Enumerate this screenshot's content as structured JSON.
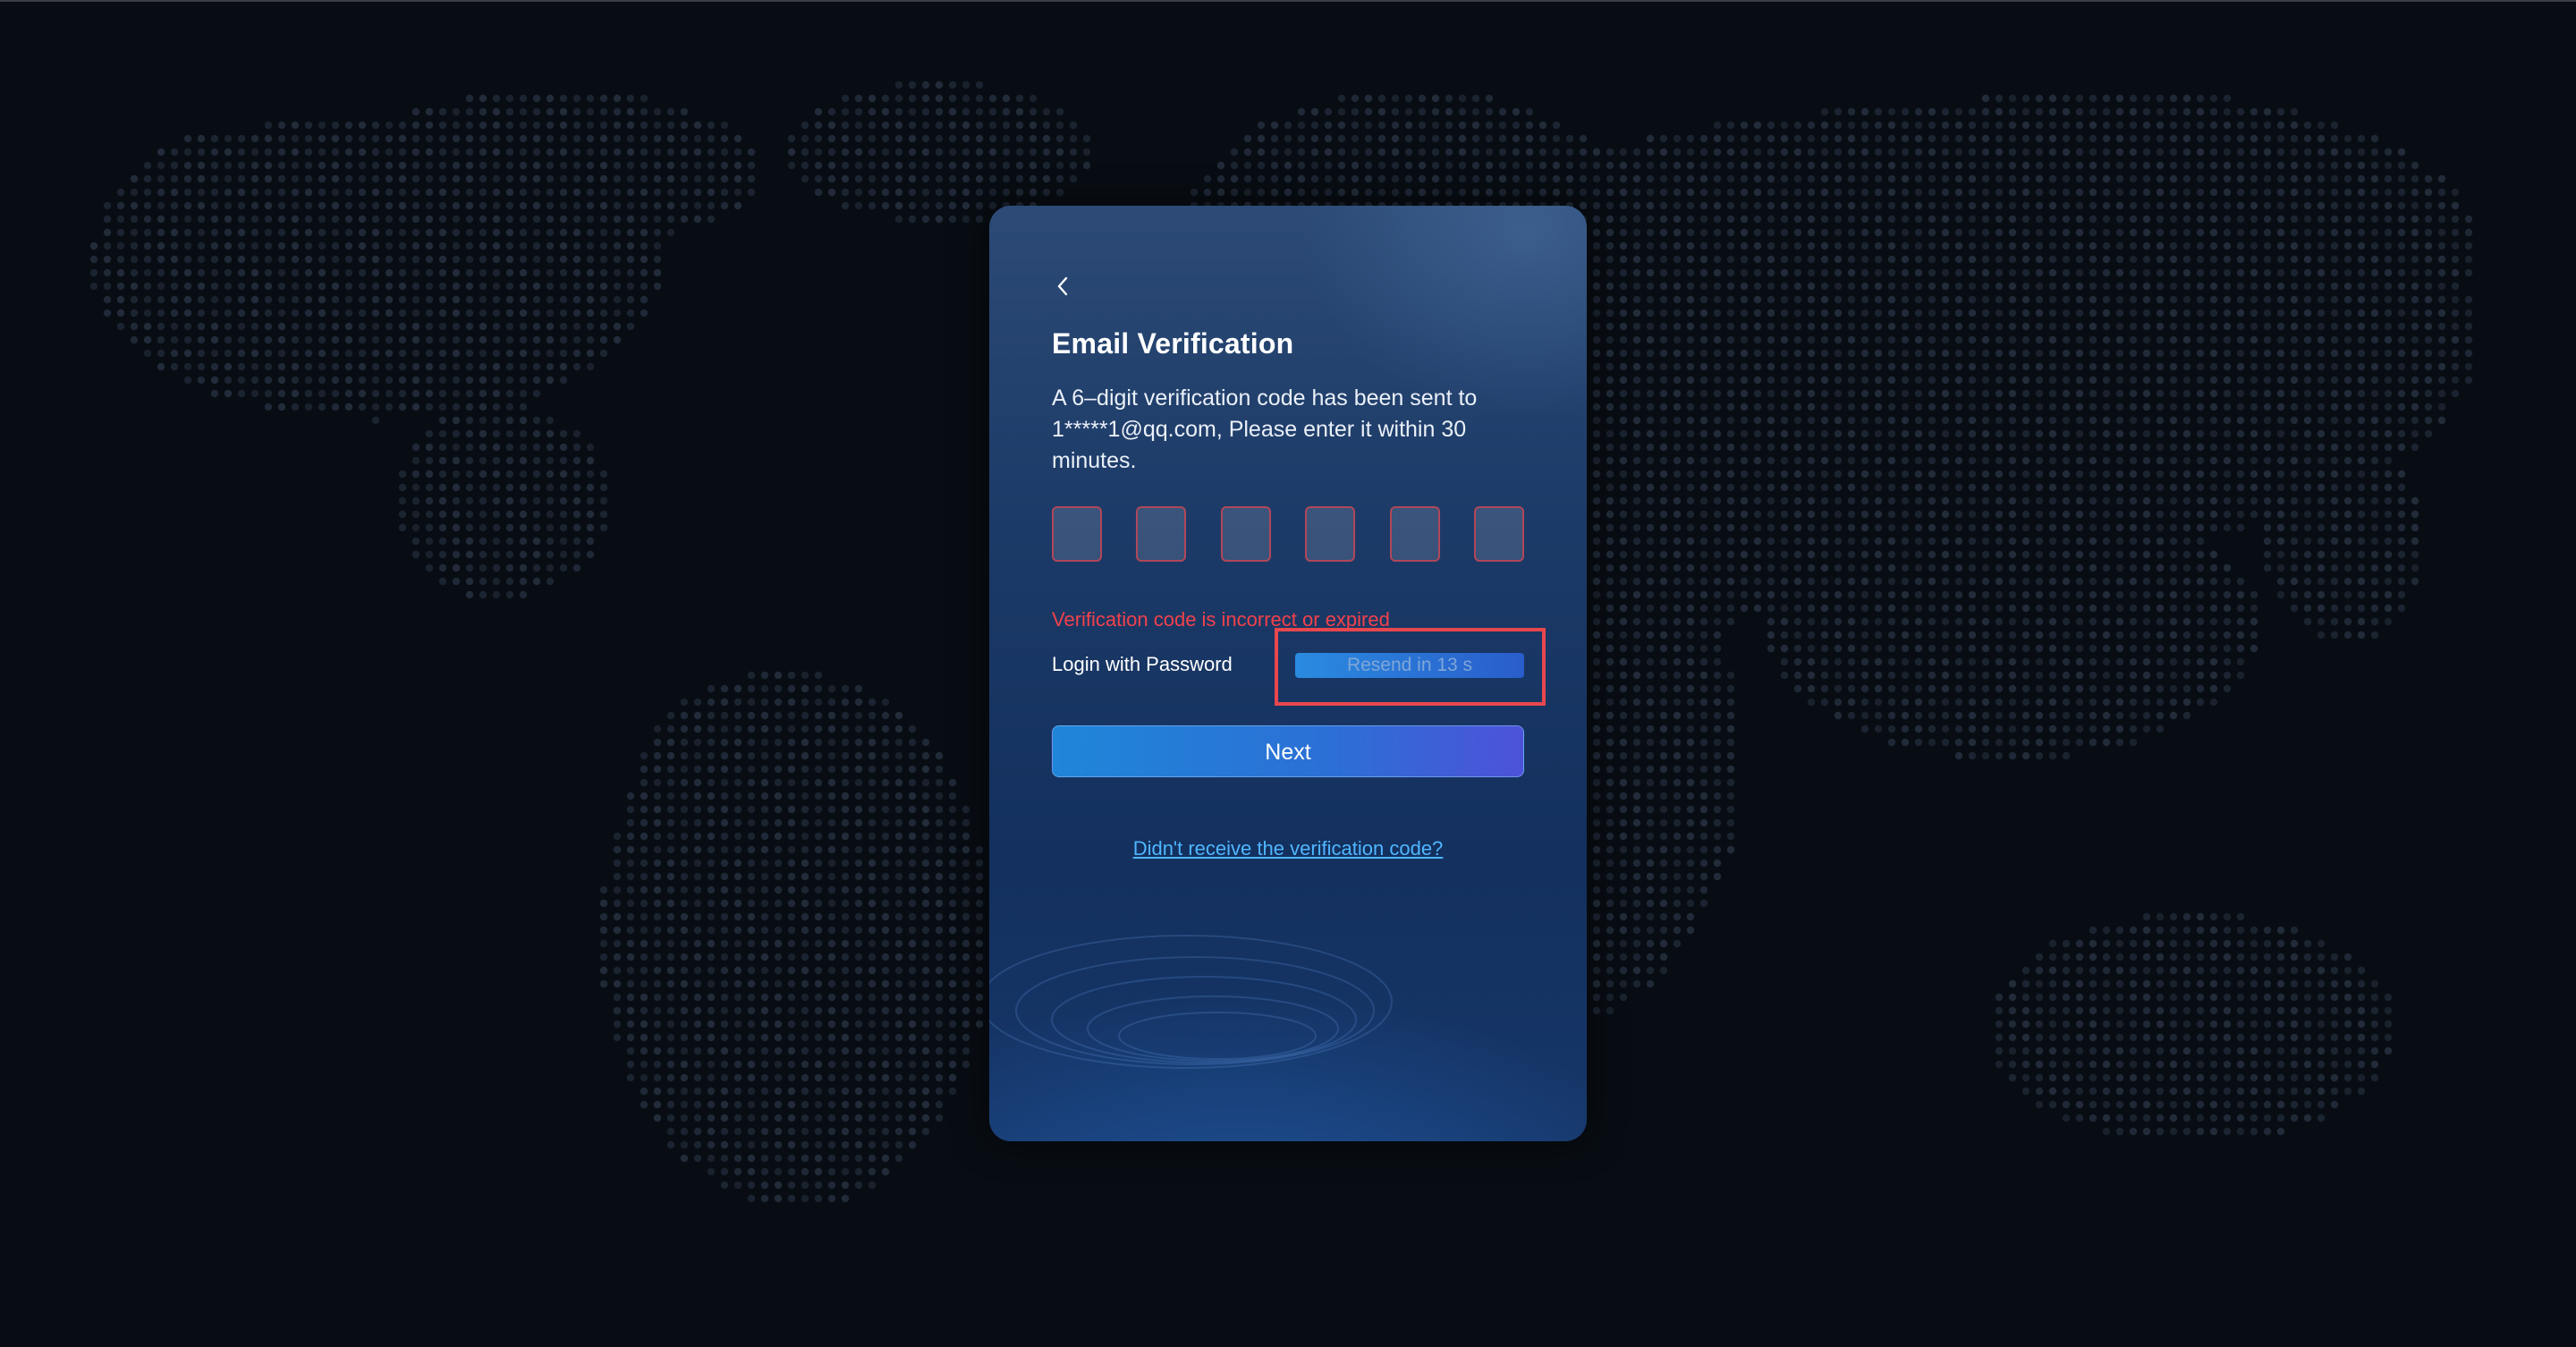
{
  "colors": {
    "background": "#080d13",
    "accent": "#2a7fe0",
    "error": "#f2414b",
    "link": "#4fb6ff",
    "highlight": "#e8474d"
  },
  "card": {
    "back_icon": "chevron-left-icon",
    "title": "Email Verification",
    "description": "A 6–digit verification code has been sent to 1*****1@qq.com, Please enter it within 30 minutes.",
    "code_digits": [
      "",
      "",
      "",
      "",
      "",
      ""
    ],
    "error_message": "Verification code is incorrect or expired",
    "login_with_password": "Login with Password",
    "resend_label": "Resend in 13 s",
    "next_label": "Next",
    "no_code_link": "Didn't receive the verification code?"
  }
}
